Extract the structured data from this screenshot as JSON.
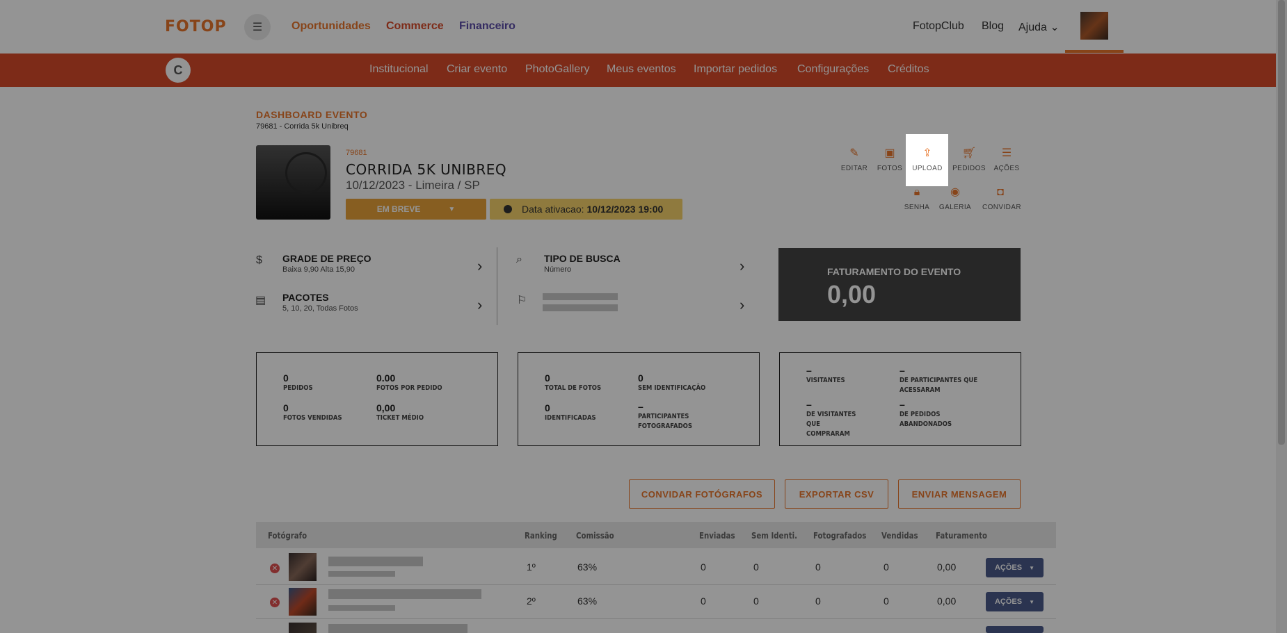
{
  "topbar": {
    "logo": "FOTOP",
    "menu_icon": "hamburger-icon",
    "links": [
      {
        "label": "Oportunidades",
        "color": "#e8762b"
      },
      {
        "label": "Commerce",
        "color": "#d84a2a"
      },
      {
        "label": "Financeiro",
        "color": "#5a4aa8"
      }
    ],
    "right_links": [
      "FotopClub",
      "Blog",
      "Ajuda"
    ]
  },
  "subnav": {
    "avatar_letter": "C",
    "links": [
      "Institucional",
      "Criar evento",
      "PhotoGallery",
      "Meus eventos",
      "Importar pedidos",
      "Configurações",
      "Créditos"
    ]
  },
  "dashboard": {
    "title": "DASHBOARD EVENTO",
    "subtitle": "79681 - Corrida 5k Unibreq"
  },
  "event": {
    "id": "79681",
    "name": "CORRIDA 5K UNIBREQ",
    "date_location": "10/12/2023 - Limeira / SP",
    "status": "EM BREVE",
    "activation_label": "Data ativacao:",
    "activation_value": "10/12/2023 19:00"
  },
  "actions_row1": [
    {
      "label": "EDITAR",
      "icon": "edit-icon"
    },
    {
      "label": "FOTOS",
      "icon": "photos-icon"
    },
    {
      "label": "UPLOAD",
      "icon": "upload-icon"
    },
    {
      "label": "PEDIDOS",
      "icon": "cart-icon"
    },
    {
      "label": "AÇÕES",
      "icon": "list-icon"
    }
  ],
  "actions_row2": [
    {
      "label": "SENHA",
      "icon": "lock-icon"
    },
    {
      "label": "GALERIA",
      "icon": "eye-icon"
    },
    {
      "label": "CONVIDAR",
      "icon": "camera-icon"
    }
  ],
  "info": {
    "price_grid": {
      "title": "GRADE DE PREÇO",
      "sub": "Baixa 9,90 Alta 15,90"
    },
    "packages": {
      "title": "PACOTES",
      "sub": "5, 10, 20, Todas Fotos"
    },
    "search_type": {
      "title": "TIPO DE BUSCA",
      "sub": "Número"
    }
  },
  "revenue": {
    "title": "FATURAMENTO DO EVENTO",
    "value": "0,00"
  },
  "stats_sales": [
    {
      "value": "0",
      "label": "PEDIDOS"
    },
    {
      "value": "0.00",
      "label": "FOTOS POR PEDIDO"
    },
    {
      "value": "0",
      "label": "FOTOS VENDIDAS"
    },
    {
      "value": "0,00",
      "label": "TICKET MÉDIO"
    }
  ],
  "stats_photos": [
    {
      "value": "0",
      "label": "TOTAL DE FOTOS"
    },
    {
      "value": "0",
      "label": "SEM IDENTIFICAÇÃO"
    },
    {
      "value": "0",
      "label": "IDENTIFICADAS"
    },
    {
      "value": "–",
      "label": "PARTICIPANTES FOTOGRAFADOS"
    }
  ],
  "stats_visitors": [
    {
      "value": "–",
      "label": "VISITANTES"
    },
    {
      "value": "–",
      "label": "DE PARTICIPANTES QUE ACESSARAM"
    },
    {
      "value": "–",
      "label": "DE VISITANTES QUE COMPRARAM"
    },
    {
      "value": "–",
      "label": "DE PEDIDOS ABANDONADOS"
    }
  ],
  "buttons": {
    "invite": "CONVIDAR FOTÓGRAFOS",
    "export": "EXPORTAR CSV",
    "message": "ENVIAR MENSAGEM"
  },
  "table": {
    "headers": [
      "Fotógrafo",
      "Ranking",
      "Comissão",
      "Enviadas",
      "Sem Identi.",
      "Fotografados",
      "Vendidas",
      "Faturamento"
    ],
    "action_label": "AÇÕES",
    "rows": [
      {
        "ranking": "1º",
        "commission": "63%",
        "sent": "0",
        "unidentified": "0",
        "photographed": "0",
        "sold": "0",
        "revenue": "0,00"
      },
      {
        "ranking": "2º",
        "commission": "63%",
        "sent": "0",
        "unidentified": "0",
        "photographed": "0",
        "sold": "0",
        "revenue": "0,00"
      }
    ]
  }
}
